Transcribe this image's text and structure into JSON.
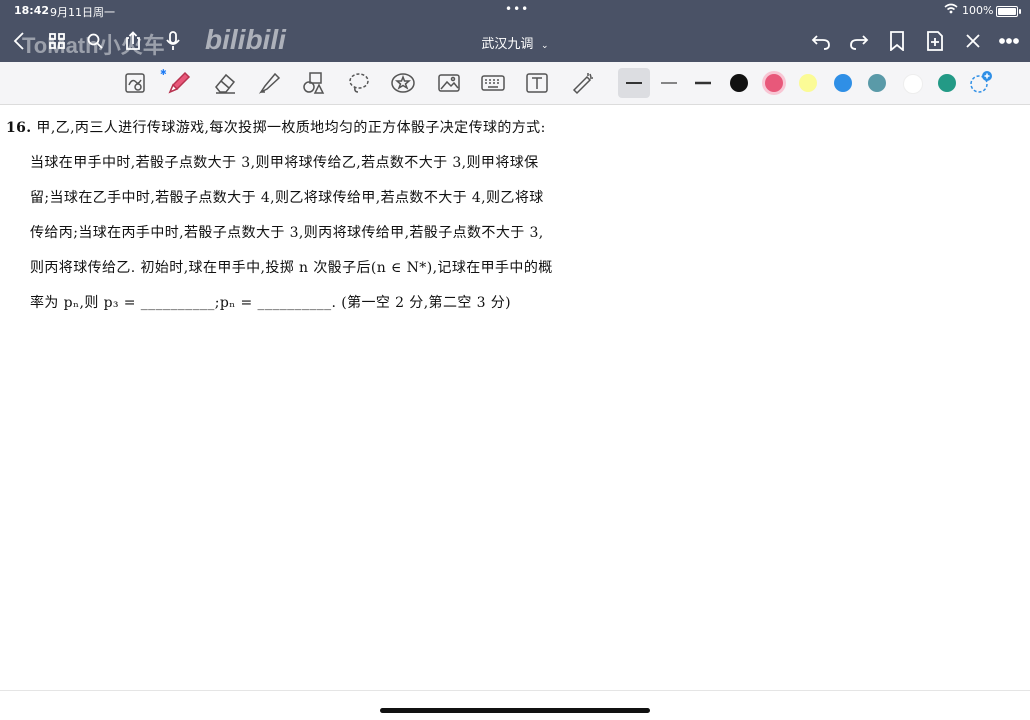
{
  "status": {
    "time": "18:42",
    "date": "9月11日周一",
    "battery": "100%"
  },
  "nav": {
    "title": "武汉九调",
    "watermark_text": "ToMath小火车",
    "watermark_logo": "bilibili"
  },
  "icons": {
    "back": "chevron-left-icon",
    "grid": "grid-icon",
    "search": "search-icon",
    "share": "share-icon",
    "bookmark": "bookmark-icon",
    "undo": "undo-icon",
    "redo": "redo-icon",
    "add_page": "add-page-icon",
    "close": "close-icon",
    "more": "more-icon"
  },
  "toolbar": {
    "colors": [
      "#111111",
      "#e8587a",
      "#fbfb96",
      "#2f8fe6",
      "#5a9aa8",
      "#ffffff",
      "#239a86"
    ],
    "selected_color": "#e8587a"
  },
  "problem": {
    "number": "16.",
    "lines": [
      "甲,乙,丙三人进行传球游戏,每次投掷一枚质地均匀的正方体骰子决定传球的方式:",
      "当球在甲手中时,若骰子点数大于 3,则甲将球传给乙,若点数不大于 3,则甲将球保",
      "留;当球在乙手中时,若骰子点数大于 4,则乙将球传给甲,若点数不大于 4,则乙将球",
      "传给丙;当球在丙手中时,若骰子点数大于 3,则丙将球传给甲,若骰子点数不大于 3,",
      "则丙将球传给乙. 初始时,球在甲手中,投掷 n 次骰子后(n ∈ N*),记球在甲手中的概",
      "率为 pₙ,则 p₃ = __________;pₙ = __________. (第一空 2 分,第二空 3 分)"
    ]
  }
}
